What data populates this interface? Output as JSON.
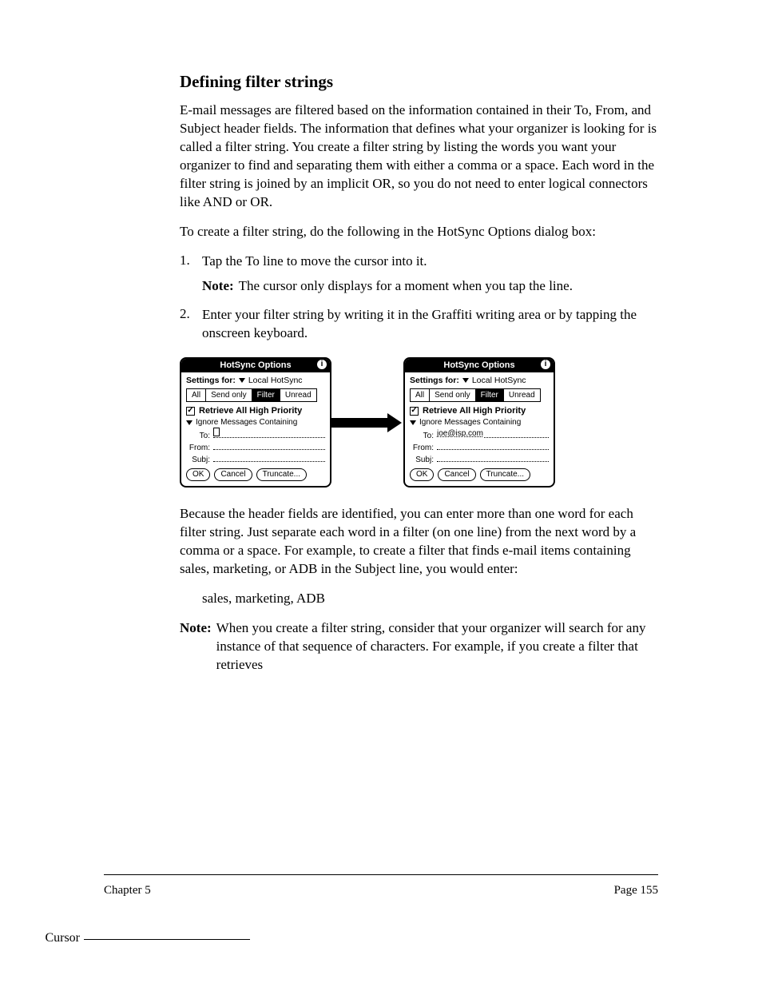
{
  "section": {
    "heading": "Defining filter strings",
    "para1": "E-mail messages are filtered based on the information contained in their To, From, and Subject header fields. The information that defines what your organizer is looking for is called a filter string. You create a filter string by listing the words you want your organizer to find and separating them with either a comma or a space. Each word in the filter string is joined by an implicit OR, so you do not need to enter logical connectors like AND or OR.",
    "procHead": "To create a filter string, do the following in the HotSync Options dialog box:",
    "step1": "Tap the To line to move the cursor into it.",
    "step2Note": "The cursor only displays for a moment when you tap the line.",
    "step2": "Enter your filter string by writing it in the Graffiti writing area or by tapping the onscreen keyboard.",
    "afterFig": "Because the header fields are identified, you can enter more than one word for each filter string. Just separate each word in a filter (on one line) from the next word by a comma or a space. For example, to create a filter that finds e-mail items containing sales, marketing, or ADB in the Subject line, you would enter:",
    "example": "sales, marketing, ADB",
    "note2Label": "Note:",
    "note2": "When you create a filter string, consider that your organizer will search for any instance of that sequence of characters. For example, if you create a filter that retrieves"
  },
  "fig": {
    "cursorLabel": "Cursor"
  },
  "dlg": {
    "title": "HotSync Options",
    "info": "i",
    "settingsForLabel": "Settings for:",
    "settingsForValue": "Local HotSync",
    "tabs": {
      "all": "All",
      "sendOnly": "Send only",
      "filter": "Filter",
      "unread": "Unread"
    },
    "checkbox": "Retrieve All High Priority",
    "dropdown": "Ignore Messages Containing",
    "fields": {
      "to": "To:",
      "from": "From:",
      "subj": "Subj:"
    },
    "rightToValue": "joe@isp.com",
    "buttons": {
      "ok": "OK",
      "cancel": "Cancel",
      "truncate": "Truncate..."
    }
  },
  "footer": {
    "left": "Chapter 5",
    "right": "Page 155"
  }
}
